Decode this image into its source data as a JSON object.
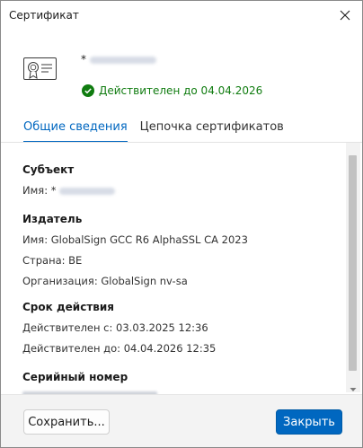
{
  "window": {
    "title": "Сертификат"
  },
  "header": {
    "subject_prefix": "*",
    "validity_text": "Действителен до 04.04.2026",
    "colors": {
      "valid": "#107c10"
    }
  },
  "tabs": [
    {
      "label": "Общие сведения",
      "active": true
    },
    {
      "label": "Цепочка сертификатов",
      "active": false
    }
  ],
  "details": {
    "subject": {
      "heading": "Субъект",
      "name_label": "Имя: *"
    },
    "issuer": {
      "heading": "Издатель",
      "name": "Имя: GlobalSign GCC R6 AlphaSSL CA 2023",
      "country": "Страна: BE",
      "organization": "Организация: GlobalSign nv-sa"
    },
    "validity_period": {
      "heading": "Срок действия",
      "from": "Действителен с: 03.03.2025 12:36",
      "to": "Действителен до: 04.04.2026 12:35"
    },
    "serial": {
      "heading": "Серийный номер"
    }
  },
  "footer": {
    "save_label": "Сохранить...",
    "close_label": "Закрыть"
  },
  "colors": {
    "accent": "#0067c0"
  }
}
